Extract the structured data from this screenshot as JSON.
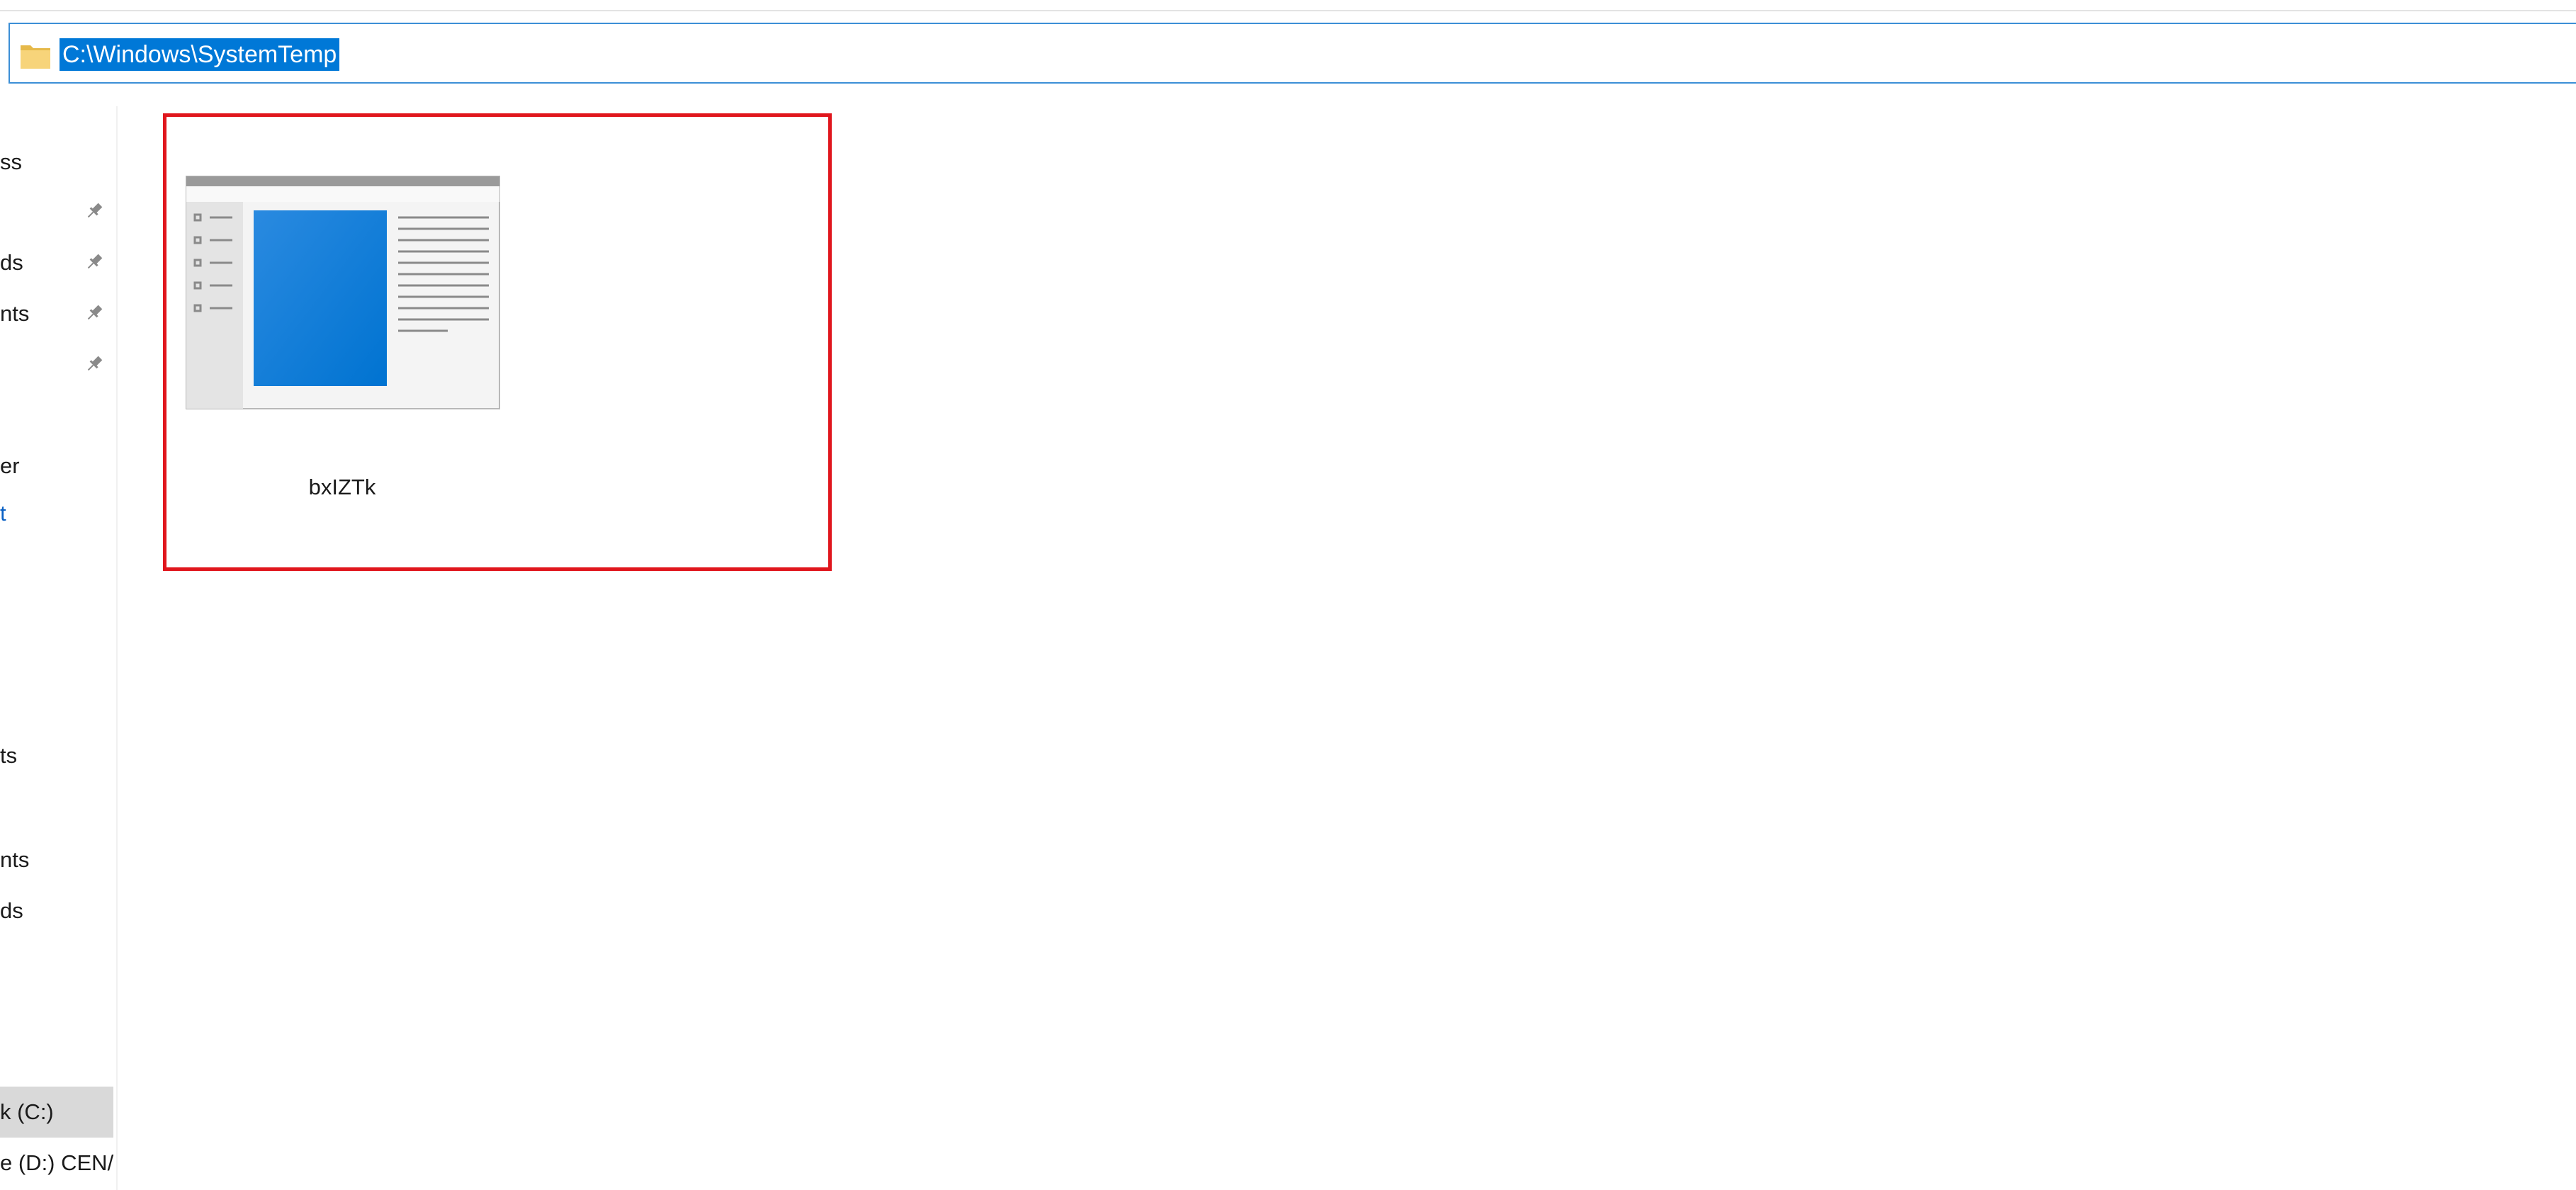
{
  "address_bar": {
    "path": "C:\\Windows\\SystemTemp",
    "icon": "folder-icon"
  },
  "nav": {
    "items": [
      {
        "label": "ss"
      },
      {
        "label": "ds"
      },
      {
        "label": "nts"
      },
      {
        "label": "er"
      },
      {
        "label": "t"
      },
      {
        "label": "ts"
      },
      {
        "label": "nts"
      },
      {
        "label": "ds"
      },
      {
        "label": "k (C:)"
      },
      {
        "label": "e (D:) CEN/"
      }
    ],
    "pin_icon": "pin-icon"
  },
  "files": [
    {
      "name": "bxIZTk",
      "icon": "application-window-thumbnail"
    }
  ],
  "colors": {
    "selection": "#0078d7",
    "address_border": "#3c8fd6",
    "highlight": "#e0161d",
    "folder": "#f7d47a"
  }
}
